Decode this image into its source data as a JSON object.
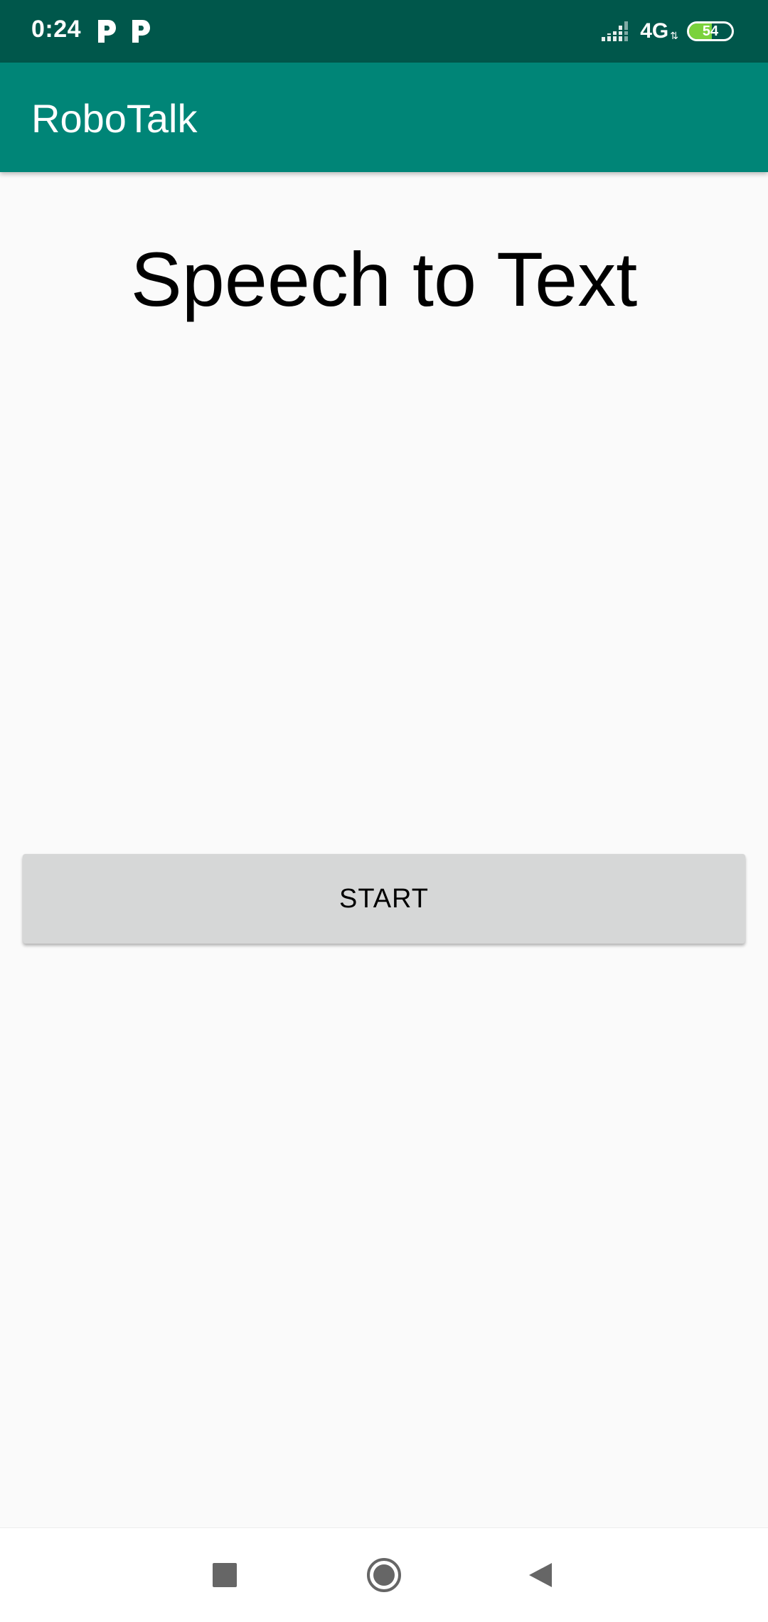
{
  "status_bar": {
    "time": "0:24",
    "network": "4G",
    "battery_level": "54",
    "battery_fraction": 0.54,
    "icons": [
      "parking-icon",
      "parking-icon",
      "signal-icon",
      "battery-icon"
    ]
  },
  "app_bar": {
    "title": "RoboTalk",
    "color": "#008577"
  },
  "main": {
    "headline": "Speech to Text",
    "start_button": "START"
  },
  "nav_bar": {
    "icons": [
      "recents-icon",
      "home-icon",
      "back-icon"
    ]
  },
  "colors": {
    "status_bar": "#00574b",
    "app_bar": "#008577",
    "background": "#fafafa",
    "button": "#d6d7d7"
  }
}
